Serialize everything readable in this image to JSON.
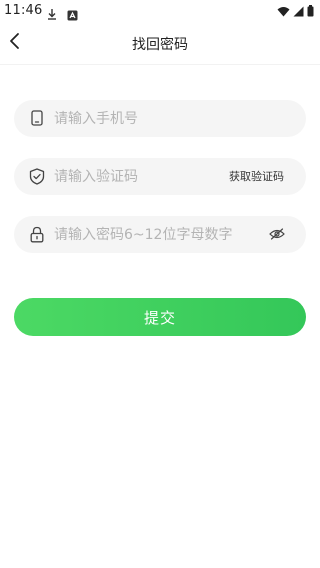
{
  "status_bar": {
    "time": "11:46",
    "icons": [
      "download-icon",
      "app-notification-icon",
      "wifi-icon",
      "signal-icon",
      "battery-icon"
    ]
  },
  "nav": {
    "title": "找回密码",
    "back_icon": "chevron-left-icon"
  },
  "form": {
    "phone": {
      "placeholder": "请输入手机号",
      "value": "",
      "icon": "phone-icon"
    },
    "code": {
      "placeholder": "请输入验证码",
      "value": "",
      "icon": "shield-check-icon",
      "action_label": "获取验证码"
    },
    "password": {
      "placeholder": "请输入密码6~12位字母数字",
      "value": "",
      "icon": "lock-icon",
      "toggle_icon": "eye-hidden-icon"
    },
    "submit_label": "提交"
  },
  "colors": {
    "accent_start": "#4cd964",
    "accent_end": "#34c759",
    "input_bg": "#f5f5f5",
    "placeholder": "#b4b4b4"
  }
}
